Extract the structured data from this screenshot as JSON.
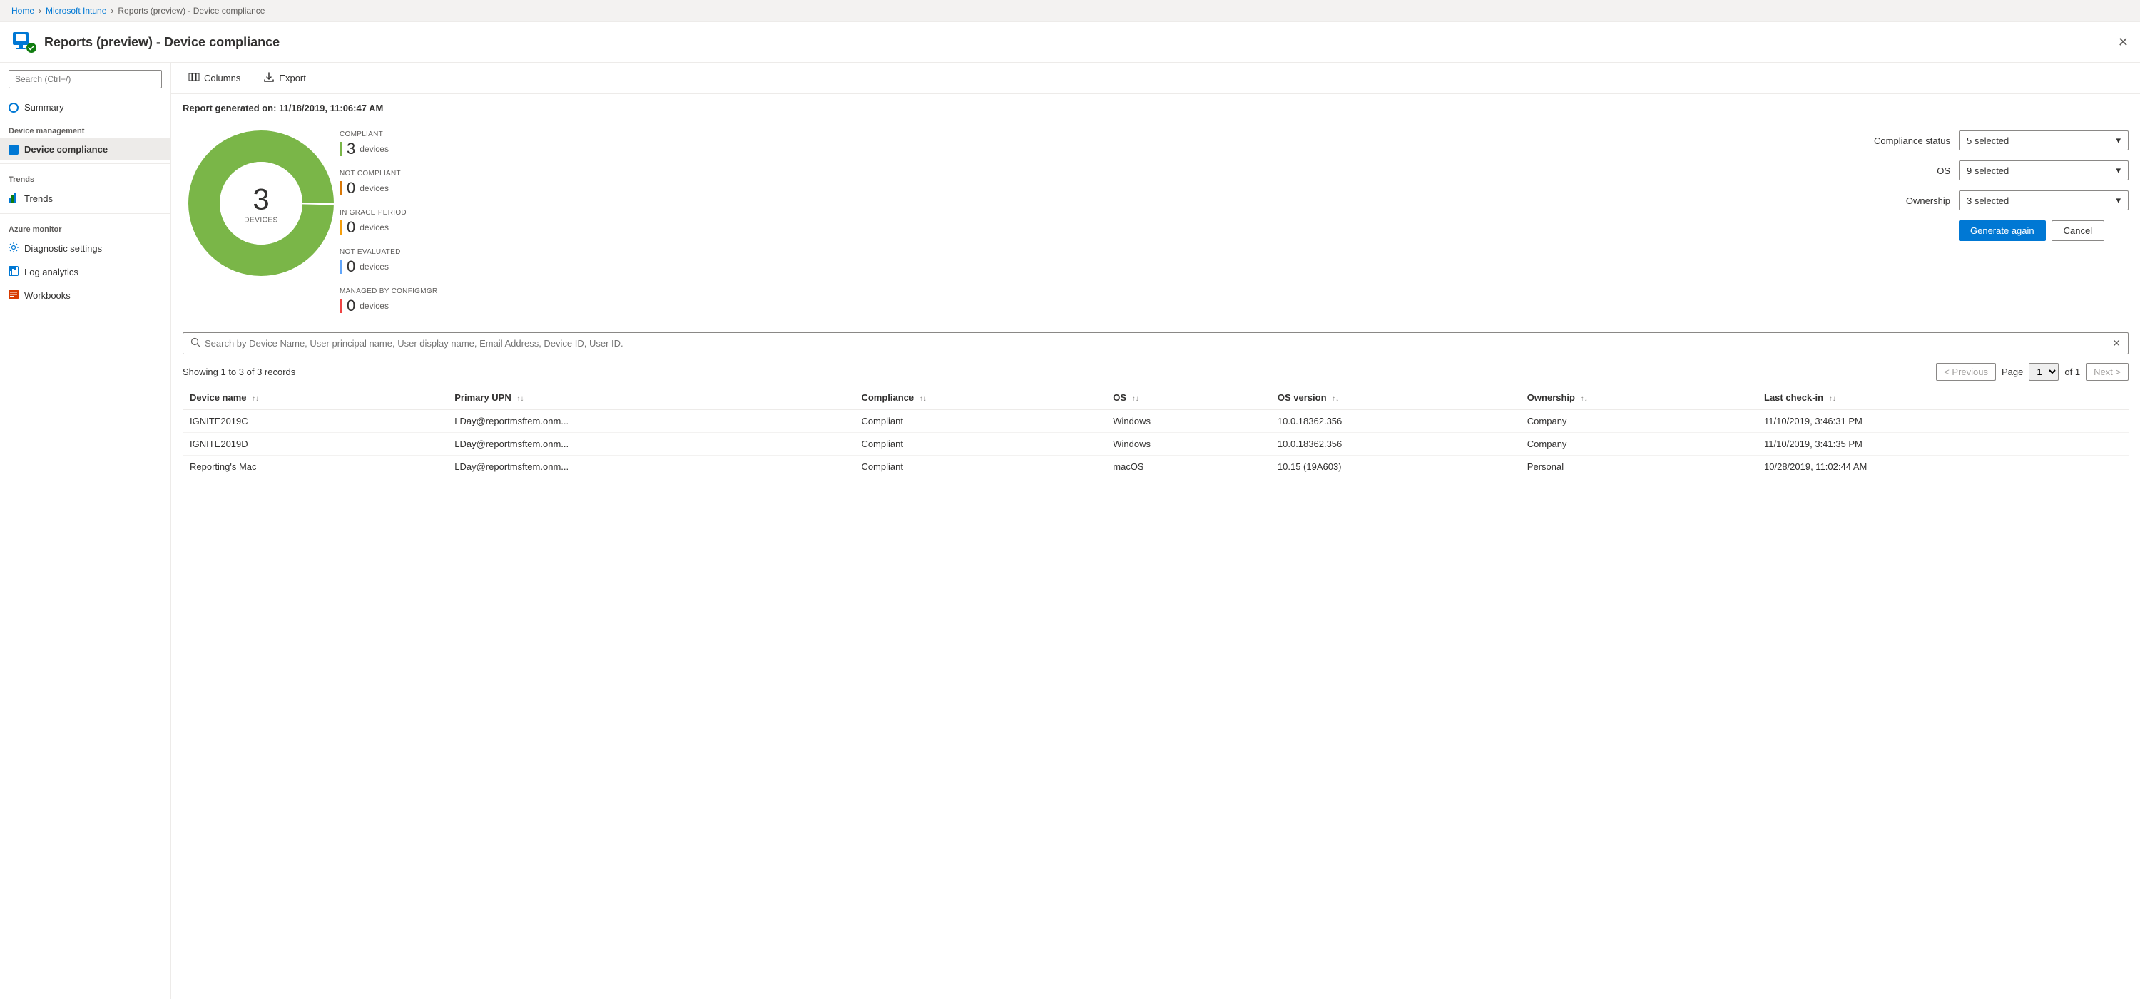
{
  "breadcrumb": {
    "items": [
      "Home",
      "Microsoft Intune",
      "Reports (preview) - Device compliance"
    ]
  },
  "pageTitle": "Reports (preview) - Device compliance",
  "sidebar": {
    "searchPlaceholder": "Search (Ctrl+/)",
    "items": [
      {
        "id": "summary",
        "label": "Summary",
        "section": null,
        "active": false,
        "icon": "circle-icon"
      },
      {
        "id": "device-compliance",
        "label": "Device compliance",
        "section": "Device management",
        "active": true,
        "icon": "device-icon"
      },
      {
        "id": "trends",
        "label": "Trends",
        "section": "Trends",
        "active": false,
        "icon": "bar-icon"
      },
      {
        "id": "diagnostic-settings",
        "label": "Diagnostic settings",
        "section": "Azure monitor",
        "active": false,
        "icon": "gear-icon"
      },
      {
        "id": "log-analytics",
        "label": "Log analytics",
        "section": null,
        "active": false,
        "icon": "analytics-icon"
      },
      {
        "id": "workbooks",
        "label": "Workbooks",
        "section": null,
        "active": false,
        "icon": "workbook-icon"
      }
    ]
  },
  "toolbar": {
    "columns_label": "Columns",
    "export_label": "Export"
  },
  "report": {
    "generated_label": "Report generated on: 11/18/2019, 11:06:47 AM"
  },
  "chart": {
    "center_value": "3",
    "center_label": "DEVICES",
    "legend": [
      {
        "label": "COMPLIANT",
        "value": "3",
        "unit": "devices",
        "color": "#7ab648"
      },
      {
        "label": "NOT COMPLIANT",
        "value": "0",
        "unit": "devices",
        "color": "#d97706"
      },
      {
        "label": "IN GRACE PERIOD",
        "value": "0",
        "unit": "devices",
        "color": "#f59e0b"
      },
      {
        "label": "NOT EVALUATED",
        "value": "0",
        "unit": "devices",
        "color": "#60a5fa"
      },
      {
        "label": "MANAGED BY CONFIGMGR",
        "value": "0",
        "unit": "devices",
        "color": "#ef4444"
      }
    ]
  },
  "filters": {
    "compliance_status_label": "Compliance status",
    "compliance_status_value": "5 selected",
    "os_label": "OS",
    "os_value": "9 selected",
    "ownership_label": "Ownership",
    "ownership_value": "3 selected",
    "generate_label": "Generate again",
    "cancel_label": "Cancel"
  },
  "search": {
    "placeholder": "Search by Device Name, User principal name, User display name, Email Address, Device ID, User ID."
  },
  "records": {
    "info": "Showing 1 to 3 of 3 records",
    "page_label": "Page",
    "page_value": "1",
    "of_label": "of 1",
    "prev_label": "< Previous",
    "next_label": "Next >"
  },
  "table": {
    "columns": [
      {
        "id": "device-name",
        "label": "Device name"
      },
      {
        "id": "primary-upn",
        "label": "Primary UPN"
      },
      {
        "id": "compliance",
        "label": "Compliance"
      },
      {
        "id": "os",
        "label": "OS"
      },
      {
        "id": "os-version",
        "label": "OS version"
      },
      {
        "id": "ownership",
        "label": "Ownership"
      },
      {
        "id": "last-checkin",
        "label": "Last check-in"
      }
    ],
    "rows": [
      {
        "device_name": "IGNITE2019C",
        "primary_upn": "LDay@reportmsftem.onm...",
        "compliance": "Compliant",
        "os": "Windows",
        "os_version": "10.0.18362.356",
        "ownership": "Company",
        "last_checkin": "11/10/2019, 3:46:31 PM"
      },
      {
        "device_name": "IGNITE2019D",
        "primary_upn": "LDay@reportmsftem.onm...",
        "compliance": "Compliant",
        "os": "Windows",
        "os_version": "10.0.18362.356",
        "ownership": "Company",
        "last_checkin": "11/10/2019, 3:41:35 PM"
      },
      {
        "device_name": "Reporting's Mac",
        "primary_upn": "LDay@reportmsftem.onm...",
        "compliance": "Compliant",
        "os": "macOS",
        "os_version": "10.15 (19A603)",
        "ownership": "Personal",
        "last_checkin": "10/28/2019, 11:02:44 AM"
      }
    ]
  }
}
